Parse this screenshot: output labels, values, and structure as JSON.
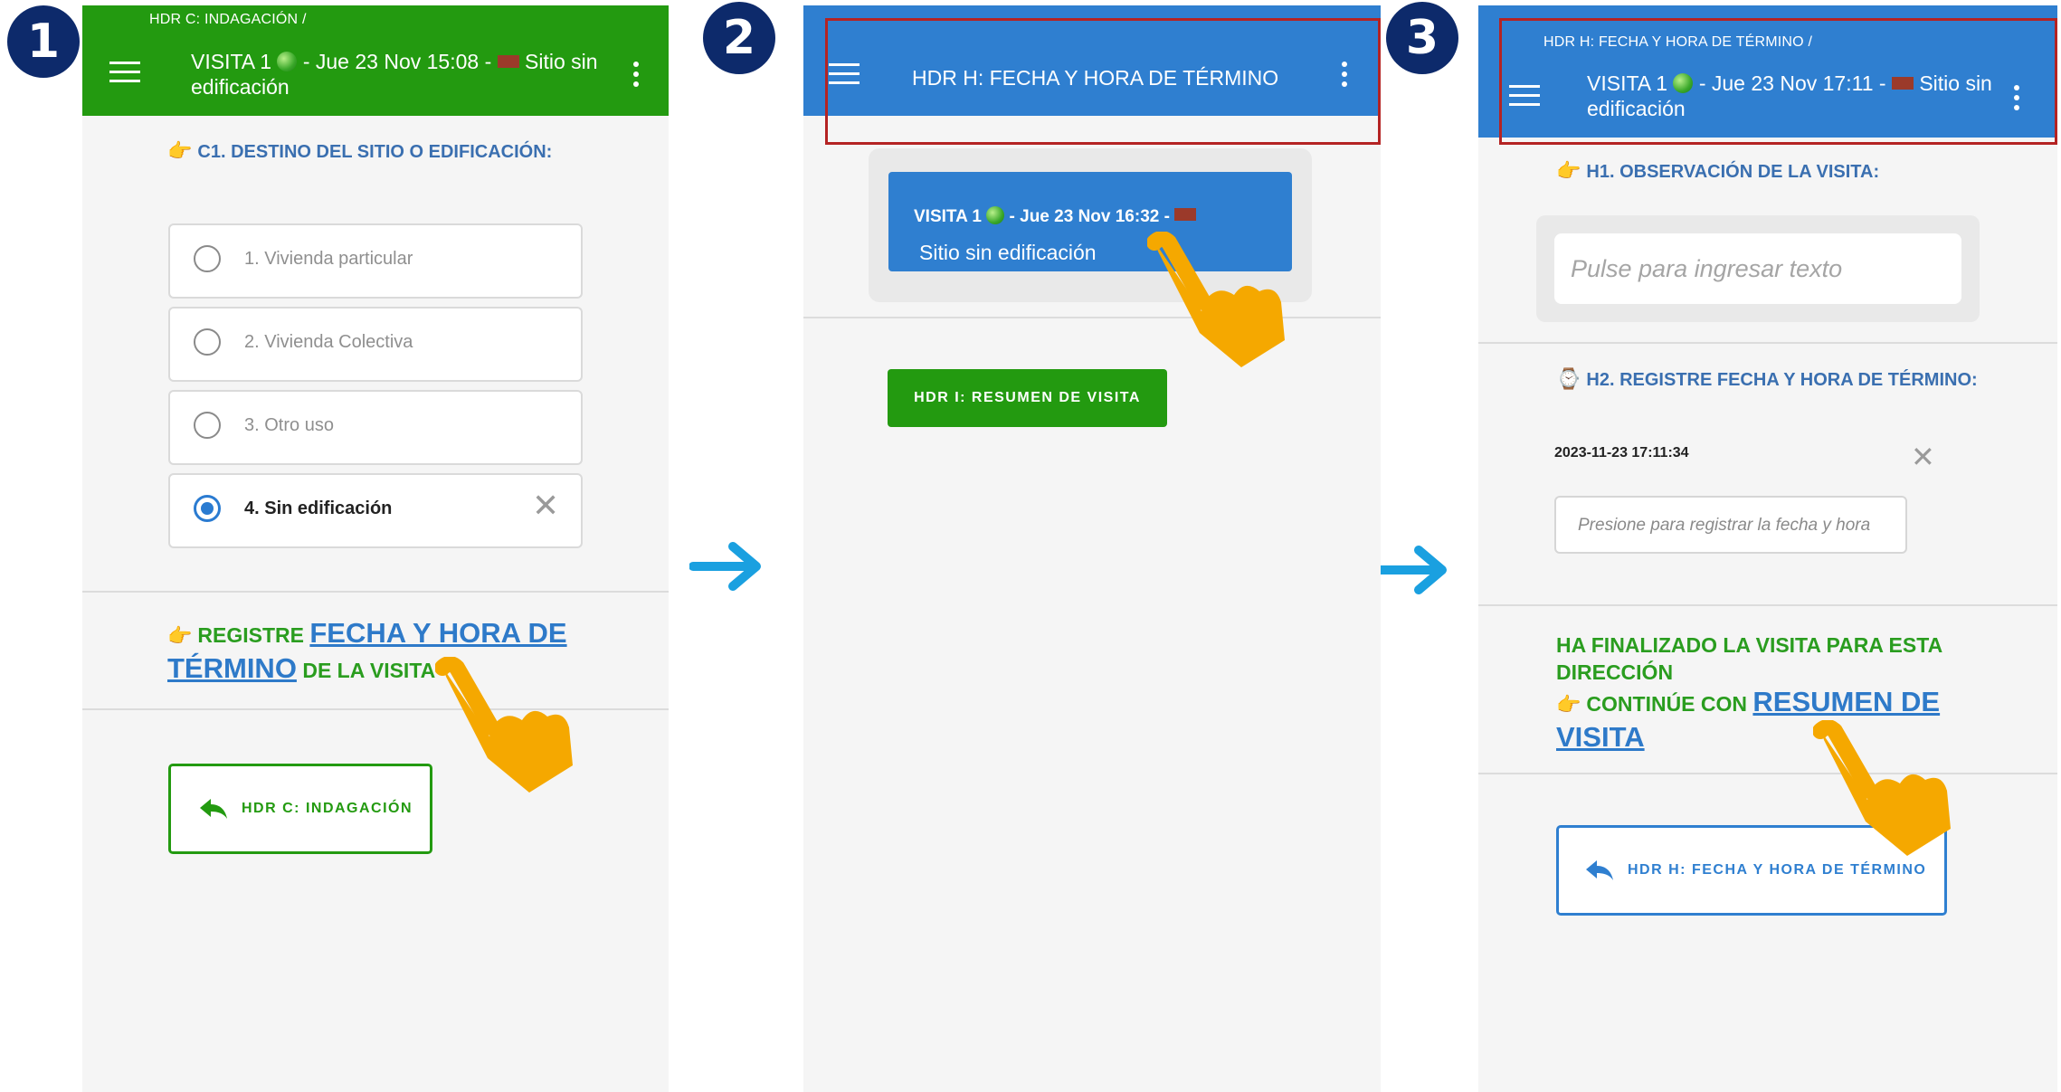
{
  "steps": [
    "1",
    "2",
    "3"
  ],
  "screen1": {
    "breadcrumb": "HDR C: INDAGACIÓN /",
    "title_prefix": "VISITA 1",
    "title_mid": "- Jue 23 Nov 15:08 -",
    "title_suffix": "Sitio sin",
    "title_line2": "edificación",
    "section": "C1. DESTINO DEL SITIO O EDIFICACIÓN:",
    "options": [
      "1. Vivienda particular",
      "2. Vivienda Colectiva",
      "3. Otro uso",
      "4. Sin edificación"
    ],
    "prompt_pre": "REGISTRE",
    "prompt_link_1": "FECHA Y HORA DE",
    "prompt_link_2": "TÉRMINO",
    "prompt_post": "DE LA VISITA",
    "back_button": "HDR C: INDAGACIÓN",
    "header_color": "#239a10"
  },
  "screen2": {
    "title": "HDR H: FECHA Y HORA DE TÉRMINO",
    "card_title_prefix": "VISITA 1",
    "card_title_mid": "- Jue 23 Nov 16:32 -",
    "card_subtitle": "Sitio sin edificación",
    "next_button": "HDR I: RESUMEN DE VISITA",
    "header_color": "#2f7fd0"
  },
  "screen3": {
    "breadcrumb": "HDR H: FECHA Y HORA DE TÉRMINO /",
    "title_prefix": "VISITA 1",
    "title_mid": "- Jue 23 Nov 17:11 -",
    "title_suffix": "Sitio sin",
    "title_line2": "edificación",
    "h1_section": "H1. OBSERVACIÓN DE LA VISITA:",
    "h1_placeholder": "Pulse para ingresar texto",
    "h2_section": "H2. REGISTRE FECHA Y HORA DE TÉRMINO:",
    "h2_value": "2023-11-23 17:11:34",
    "h2_placeholder": "Presione para registrar la fecha y hora",
    "finished_line1": "HA FINALIZADO LA VISITA PARA ESTA",
    "finished_line2": "DIRECCIÓN",
    "continue_pre": "CONTINÚE CON",
    "continue_link_1": "RESUMEN DE",
    "continue_link_2": "VISITA",
    "back_button": "HDR H: FECHA Y HORA DE TÉRMINO",
    "header_color": "#2f7fd0"
  },
  "colors": {
    "badge": "#0d2a6b",
    "arrow": "#1aa0e0",
    "highlight_box": "#b42323",
    "pointer_hand": "#f5a800",
    "section_title": "#3a6fb0",
    "prompt_green": "#2a9d1f",
    "link_blue": "#2e7ac9"
  }
}
